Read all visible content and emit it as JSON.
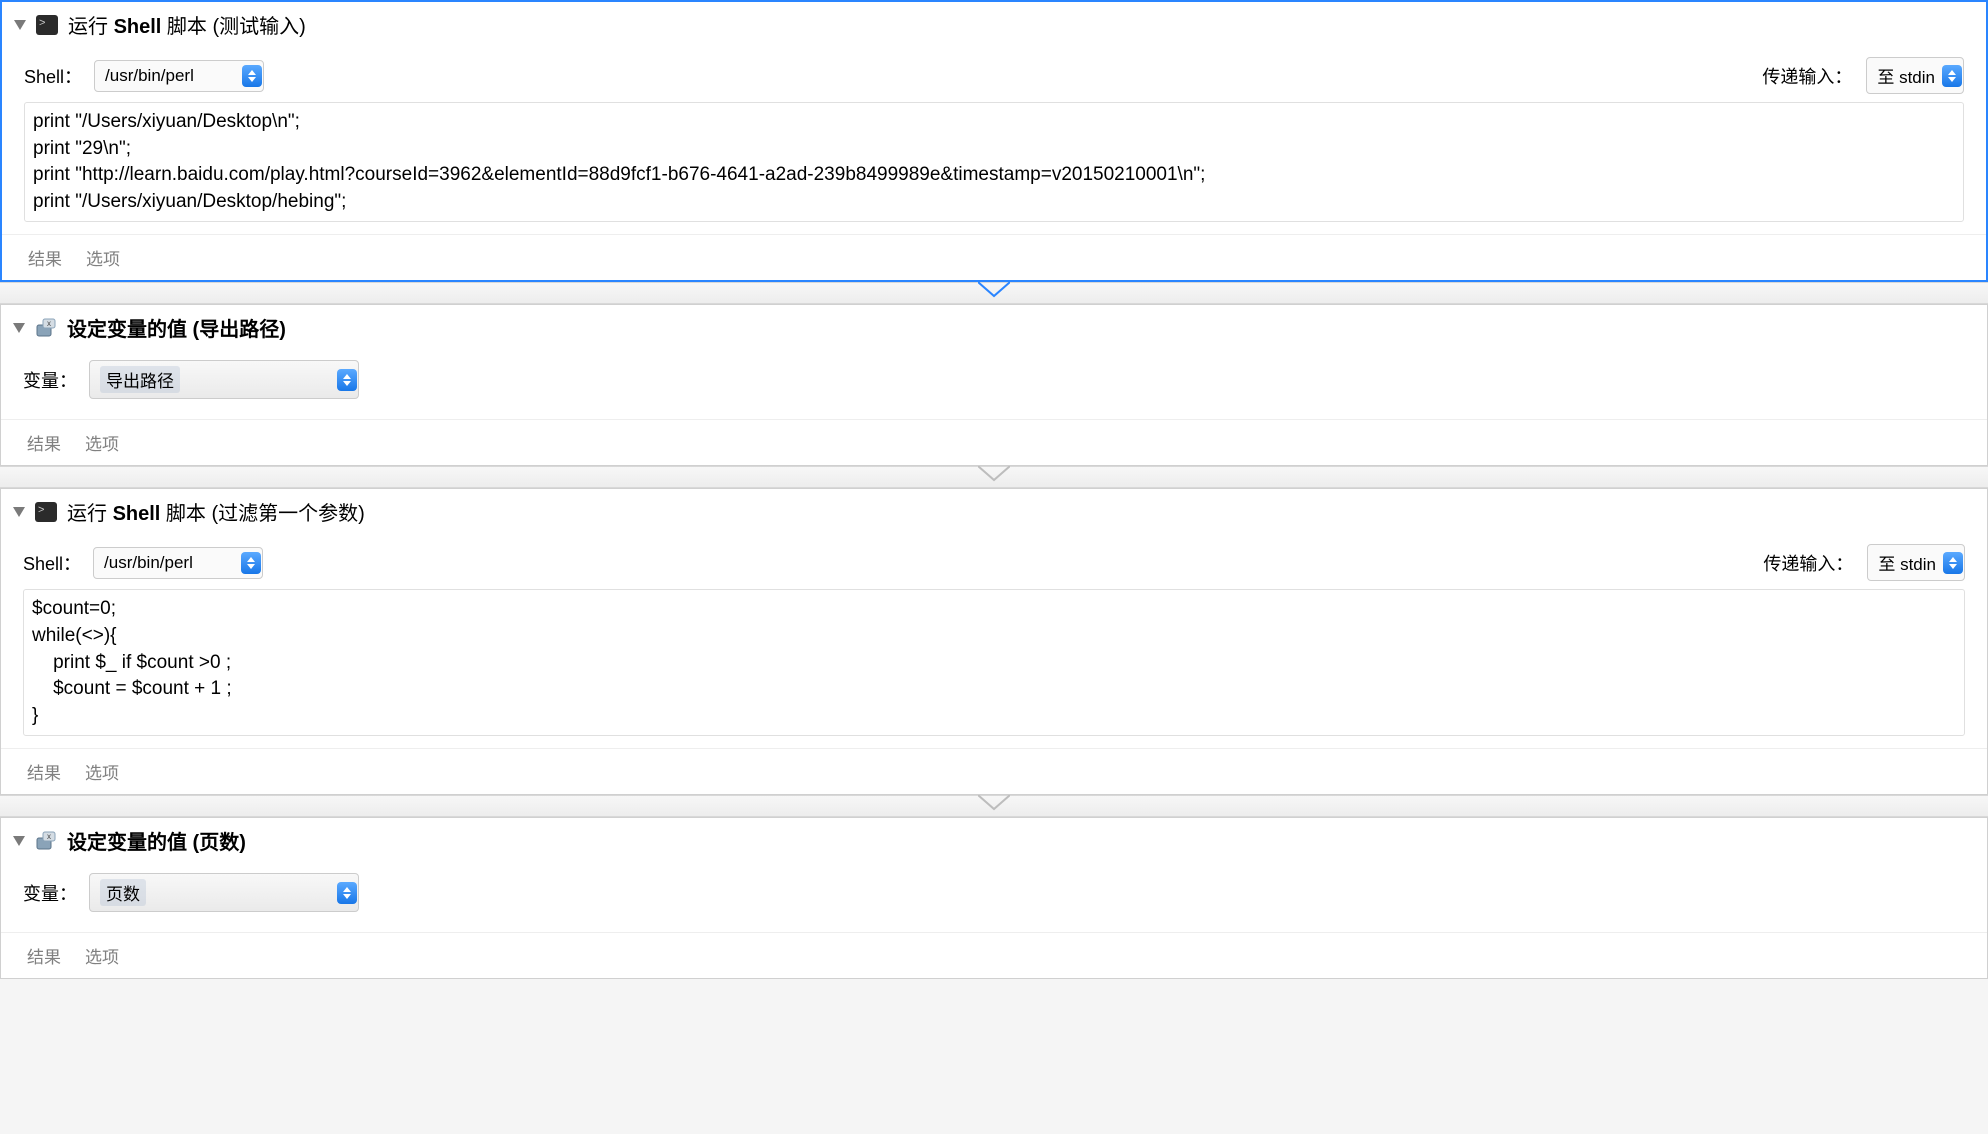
{
  "actions": [
    {
      "title_prefix": "运行 ",
      "title_bold": "Shell",
      "title_suffix": " 脚本 (测试输入)",
      "shell_label": "Shell：",
      "shell_value": "/usr/bin/perl",
      "pass_input_label": "传递输入：",
      "pass_input_value": "至 stdin",
      "code": "print \"/Users/xiyuan/Desktop\\n\";\nprint \"29\\n\";\nprint \"http://learn.baidu.com/play.html?courseId=3962&elementId=88d9fcf1-b676-4641-a2ad-239b8499989e&timestamp=v20150210001\\n\";\nprint \"/Users/xiyuan/Desktop/hebing\";",
      "result_label": "结果",
      "options_label": "选项"
    },
    {
      "title": "设定变量的值 (导出路径)",
      "variable_label": "变量：",
      "variable_value": "导出路径",
      "result_label": "结果",
      "options_label": "选项"
    },
    {
      "title_prefix": "运行 ",
      "title_bold": "Shell",
      "title_suffix": " 脚本 (过滤第一个参数)",
      "shell_label": "Shell：",
      "shell_value": "/usr/bin/perl",
      "pass_input_label": "传递输入：",
      "pass_input_value": "至 stdin",
      "code": "$count=0;\nwhile(<>){\n    print $_ if $count >0 ;\n    $count = $count + 1 ;\n}",
      "result_label": "结果",
      "options_label": "选项"
    },
    {
      "title": "设定变量的值 (页数)",
      "variable_label": "变量：",
      "variable_value": "页数",
      "result_label": "结果",
      "options_label": "选项"
    }
  ]
}
